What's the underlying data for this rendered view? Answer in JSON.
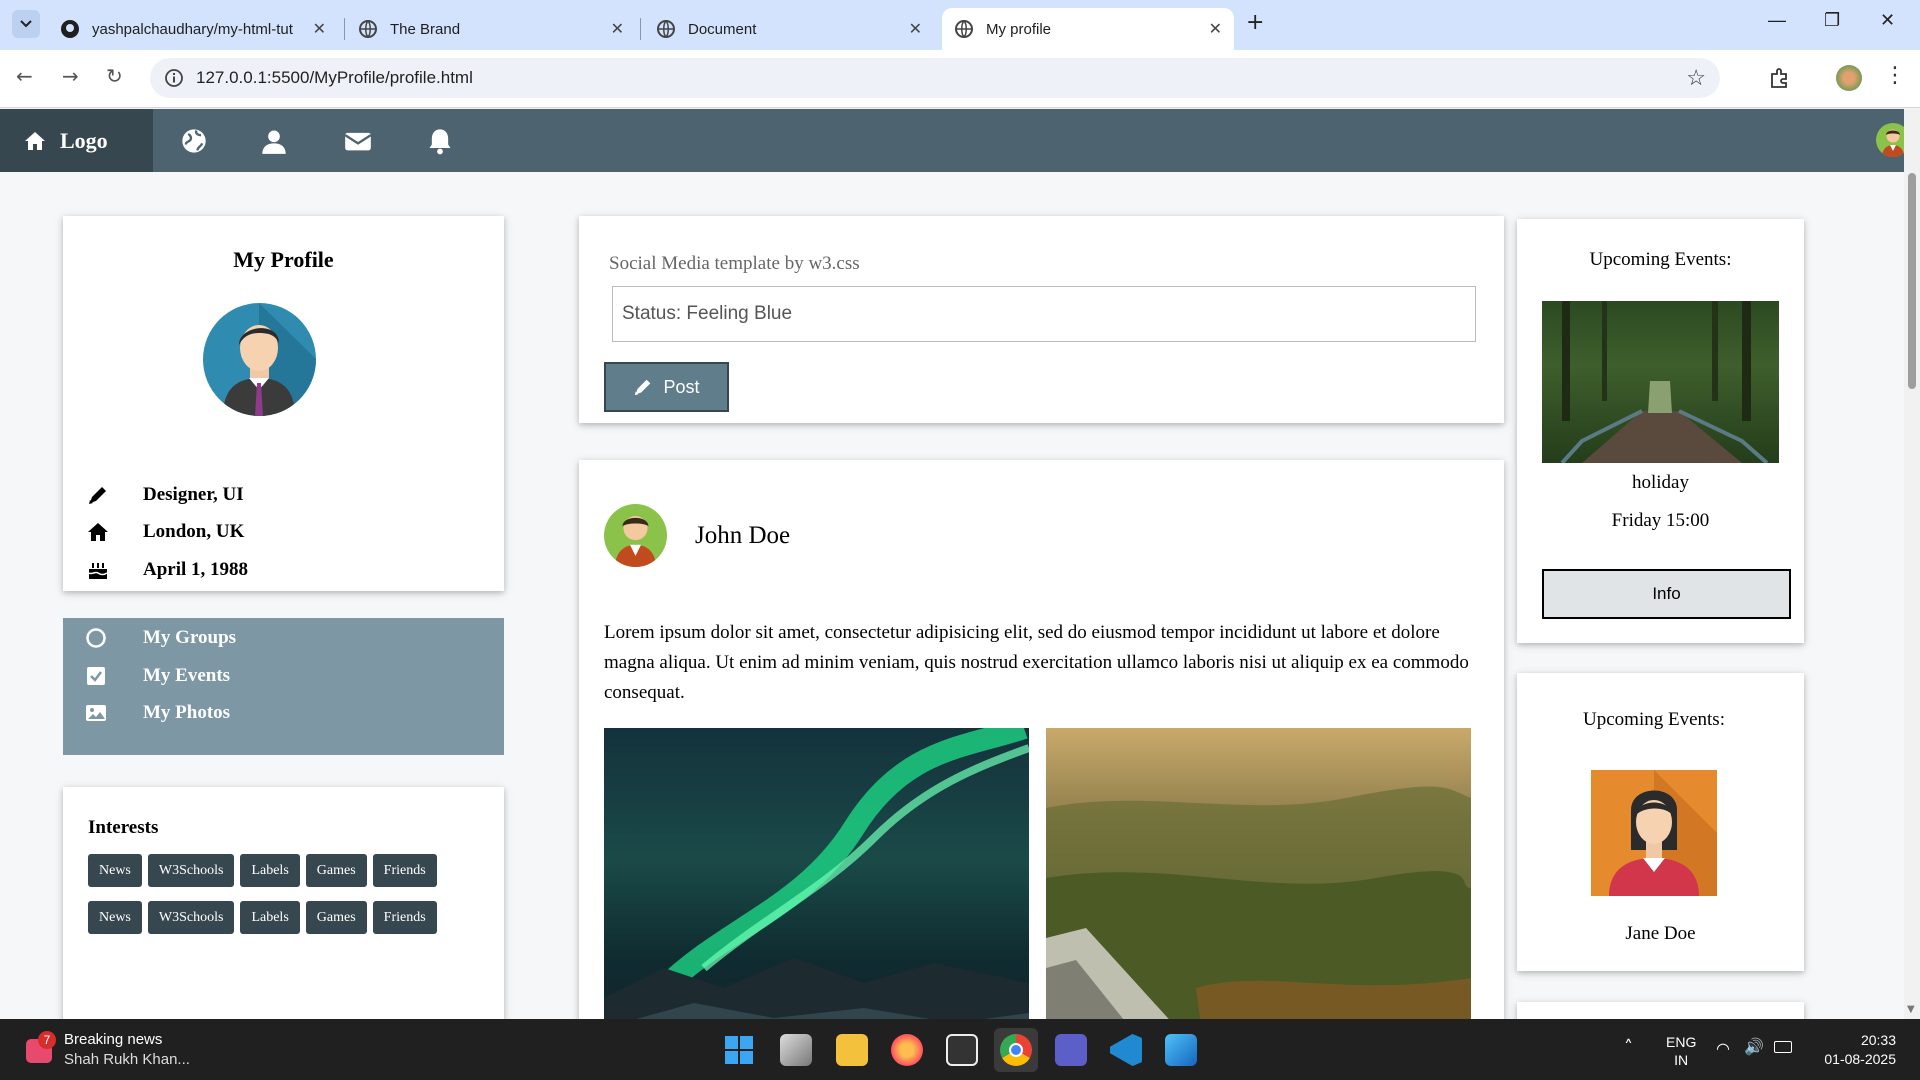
{
  "browser": {
    "tabs": [
      {
        "title": "yashpalchaudhary/my-html-tut",
        "active": false
      },
      {
        "title": "The Brand",
        "active": false
      },
      {
        "title": "Document",
        "active": false
      },
      {
        "title": "My profile",
        "active": true
      }
    ],
    "url": "127.0.0.1:5500/MyProfile/profile.html"
  },
  "nav": {
    "logo": "Logo",
    "icons": [
      "home-icon",
      "globe-icon",
      "user-icon",
      "envelope-icon",
      "bell-icon",
      "avatar"
    ]
  },
  "profile": {
    "title": "My Profile",
    "details": [
      {
        "icon": "pencil-icon",
        "text": "Designer, UI"
      },
      {
        "icon": "home-icon",
        "text": "London, UK"
      },
      {
        "icon": "birthday-cake-icon",
        "text": "April 1, 1988"
      }
    ]
  },
  "side_menu": {
    "items": [
      {
        "icon": "circle-notch-icon",
        "label": "My Groups"
      },
      {
        "icon": "check-square-icon",
        "label": "My Events"
      },
      {
        "icon": "image-icon",
        "label": "My Photos"
      }
    ]
  },
  "interests": {
    "title": "Interests",
    "tags": [
      "News",
      "W3Schools",
      "Labels",
      "Games",
      "Friends",
      "News",
      "W3Schools",
      "Labels",
      "Games",
      "Friends"
    ]
  },
  "composer": {
    "caption": "Social Media template by w3.css",
    "status_value": "Status: Feeling Blue",
    "post_label": "Post"
  },
  "post": {
    "author": "John Doe",
    "body": "Lorem ipsum dolor sit amet, consectetur adipisicing elit, sed do eiusmod tempor incididunt ut labore et dolore magna aliqua. Ut enim ad minim veniam, quis nostrud exercitation ullamco laboris nisi ut aliquip ex ea commodo consequat."
  },
  "events": {
    "title": "Upcoming Events:",
    "name": "holiday",
    "time": "Friday 15:00",
    "info_label": "Info"
  },
  "events2": {
    "title": "Upcoming Events:",
    "person": "Jane Doe"
  },
  "taskbar": {
    "news_badge": "7",
    "news_title": "Breaking news",
    "news_sub": "Shah Rukh Khan...",
    "lang1": "ENG",
    "lang2": "IN",
    "time": "20:33",
    "date": "01-08-2025"
  },
  "colors": {
    "nav": "#4d636f",
    "nav_dark": "#37474f",
    "menu": "#7d97a4",
    "taskbar": "#202020"
  }
}
